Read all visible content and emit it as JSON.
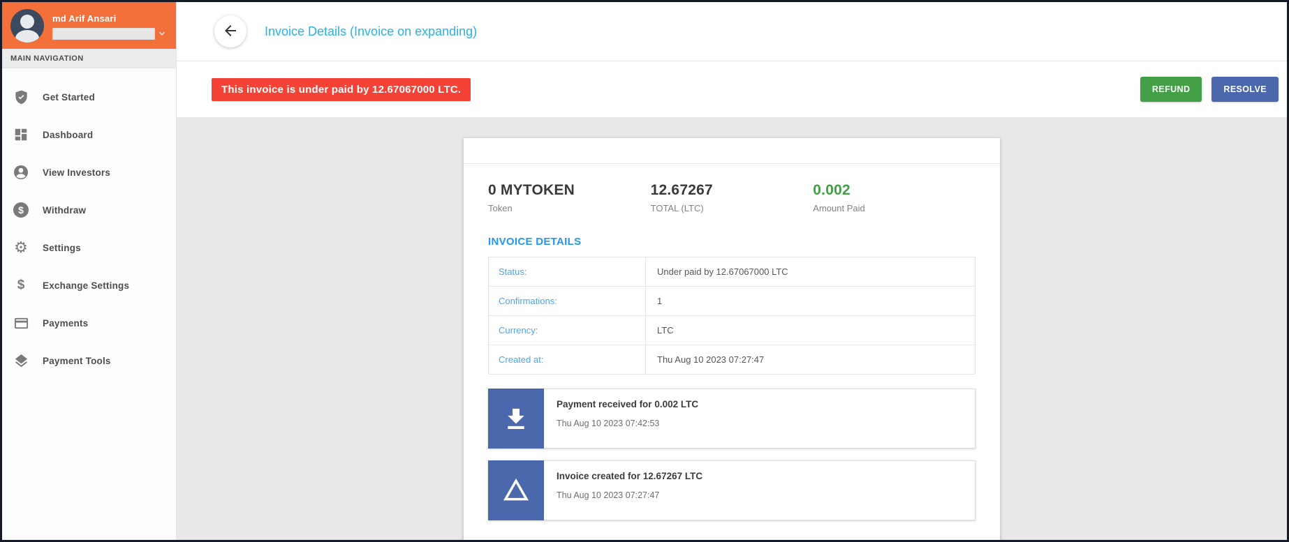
{
  "sidebar": {
    "user": {
      "name": "md Arif Ansari"
    },
    "nav_label": "MAIN NAVIGATION",
    "items": [
      {
        "label": "Get Started",
        "icon": "shield-check-icon"
      },
      {
        "label": "Dashboard",
        "icon": "dashboard-icon"
      },
      {
        "label": "View Investors",
        "icon": "person-circle-icon"
      },
      {
        "label": "Withdraw",
        "icon": "dollar-circle-icon"
      },
      {
        "label": "Settings",
        "icon": "gear-icon"
      },
      {
        "label": "Exchange Settings",
        "icon": "dollar-icon"
      },
      {
        "label": "Payments",
        "icon": "credit-card-icon"
      },
      {
        "label": "Payment Tools",
        "icon": "layers-icon"
      }
    ]
  },
  "icons": {
    "gear_glyph": "⚙",
    "dollar_glyph": "$"
  },
  "header": {
    "title": "Invoice Details (Invoice on expanding)"
  },
  "alert": {
    "message": "This invoice is under paid by 12.67067000 LTC."
  },
  "actions": {
    "refund_label": "REFUND",
    "resolve_label": "RESOLVE"
  },
  "summary": {
    "token": {
      "value": "0 MYTOKEN",
      "label": "Token"
    },
    "total": {
      "value": "12.67267",
      "label": "TOTAL (LTC)"
    },
    "paid": {
      "value": "0.002",
      "label": "Amount Paid"
    }
  },
  "invoice_details": {
    "heading": "INVOICE DETAILS",
    "rows": [
      {
        "label": "Status:",
        "value": "Under paid by 12.67067000 LTC"
      },
      {
        "label": "Confirmations:",
        "value": "1"
      },
      {
        "label": "Currency:",
        "value": "LTC"
      },
      {
        "label": "Created at:",
        "value": "Thu Aug 10 2023 07:27:47"
      }
    ]
  },
  "timeline": [
    {
      "icon": "download-icon",
      "title": "Payment received for 0.002 LTC",
      "date": "Thu Aug 10 2023 07:42:53"
    },
    {
      "icon": "triangle-icon",
      "title": "Invoice created for 12.67267 LTC",
      "date": "Thu Aug 10 2023 07:27:47"
    }
  ],
  "colors": {
    "accent_orange": "#f4703a",
    "title_cyan": "#25b5e3",
    "alert_red": "#f44336",
    "refund_green": "#43a047",
    "resolve_indigo": "#4b68ad",
    "heading_blue": "#2196f3",
    "paid_green": "#3fa142"
  }
}
